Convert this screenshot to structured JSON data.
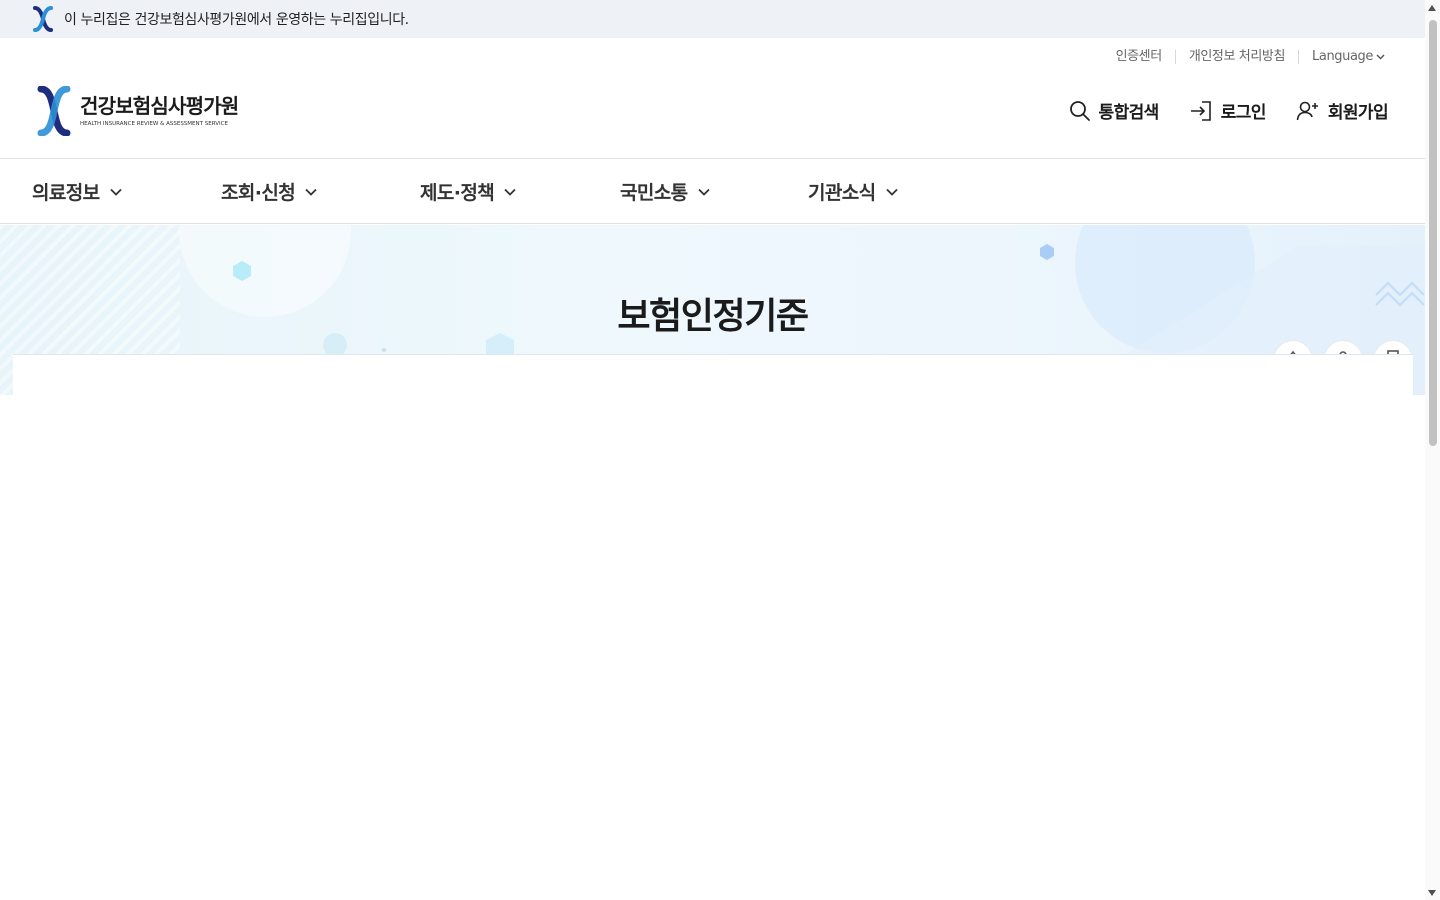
{
  "gov_banner": {
    "text": "이 누리집은 건강보험심사평가원에서 운영하는 누리집입니다."
  },
  "utility": {
    "items": [
      "인증센터",
      "개인정보 처리방침",
      "Language"
    ]
  },
  "logo": {
    "name_ko": "건강보험심사평가원",
    "name_en": "HEALTH INSURANCE REVIEW & ASSESSMENT SERVICE"
  },
  "header_actions": {
    "search": "통합검색",
    "login": "로그인",
    "signup": "회원가입"
  },
  "gnb": {
    "items": [
      "의료정보",
      "조회·신청",
      "제도·정책",
      "국민소통",
      "기관소식"
    ]
  },
  "page": {
    "title": "보험인정기준"
  },
  "colors": {
    "brand_navy": "#1e2d7d",
    "brand_blue": "#2b8fd6",
    "banner_bg": "#eef1f6"
  }
}
